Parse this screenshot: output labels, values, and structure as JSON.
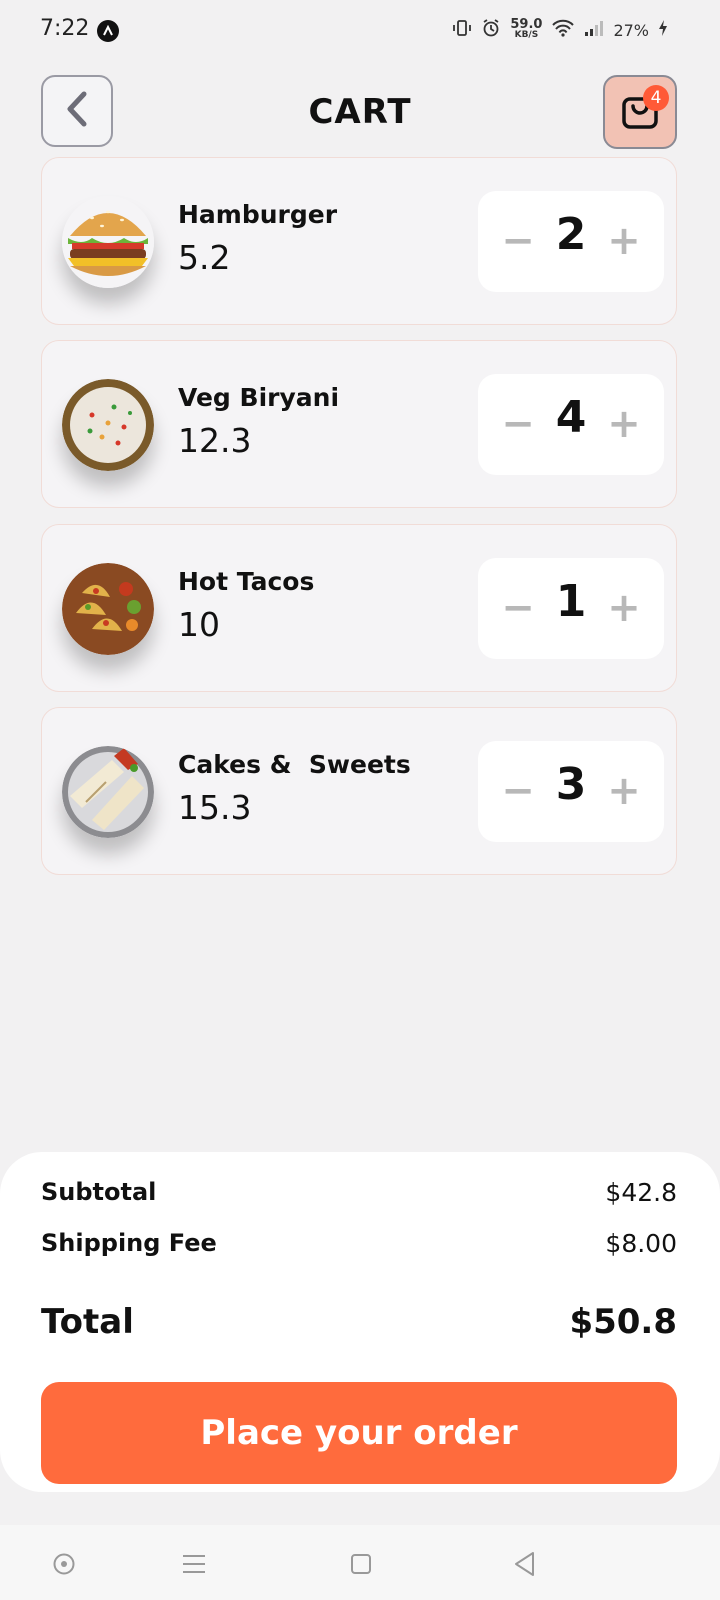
{
  "status_bar": {
    "time": "7:22",
    "speed_value": "59.0",
    "speed_unit": "KB/S",
    "battery": "27%",
    "icons": [
      "app-notification-icon",
      "vibrate-icon",
      "alarm-icon",
      "wifi-icon",
      "signal-icon",
      "charging-icon"
    ]
  },
  "header": {
    "title": "CART",
    "back_icon": "chevron-left-icon",
    "cart_icon": "shopping-bag-icon",
    "cart_count": "4"
  },
  "items": [
    {
      "name": "Hamburger",
      "price": "5.2",
      "quantity": "2",
      "minus": "−",
      "plus": "+"
    },
    {
      "name": "Veg Biryani",
      "price": "12.3",
      "quantity": "4",
      "minus": "−",
      "plus": "+"
    },
    {
      "name": "Hot Tacos",
      "price": "10",
      "quantity": "1",
      "minus": "−",
      "plus": "+"
    },
    {
      "name": "Cakes &  Sweets",
      "price": "15.3",
      "quantity": "3",
      "minus": "−",
      "plus": "+"
    }
  ],
  "summary": {
    "subtotal_label": "Subtotal",
    "subtotal_value": "$42.8",
    "shipping_label": "Shipping Fee",
    "shipping_value": "$8.00",
    "total_label": "Total",
    "total_value": "$50.8",
    "order_button": "Place your order"
  },
  "nav_bar": {
    "icons": [
      "circle-dot-icon",
      "menu-icon",
      "home-square-icon",
      "back-triangle-icon"
    ]
  },
  "colors": {
    "accent": "#ff6b3d",
    "badge": "#ff5a37",
    "background": "#f2f1f2"
  }
}
